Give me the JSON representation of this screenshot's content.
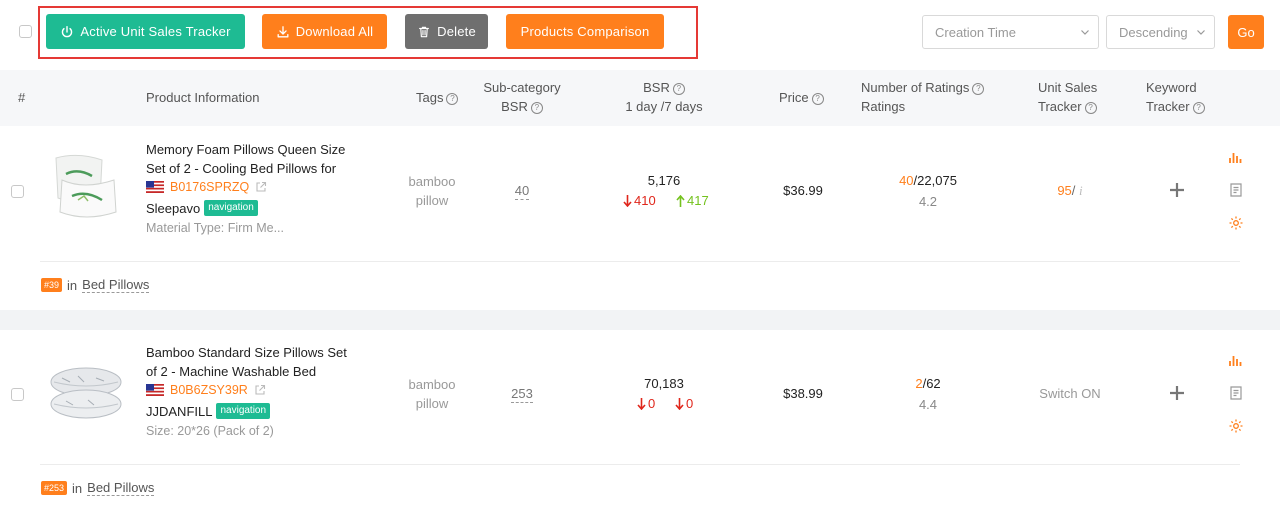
{
  "toolbar": {
    "active_tracker_label": "Active Unit Sales Tracker",
    "download_label": "Download All",
    "delete_label": "Delete",
    "compare_label": "Products Comparison",
    "sort_field": "Creation Time",
    "sort_order": "Descending",
    "go_label": "Go",
    "colors": {
      "green": "#1ebb93",
      "orange": "#ff7f1c",
      "gray": "#6f6f6f",
      "highlight": "#e53935"
    }
  },
  "header": {
    "index": "#",
    "product_info": "Product Information",
    "tags": "Tags",
    "subcat_line1": "Sub-category",
    "subcat_line2": "BSR",
    "bsr_line1": "BSR",
    "bsr_line2": "1 day /7 days",
    "price": "Price",
    "ratings_line1": "Number of Ratings",
    "ratings_line2": "Ratings",
    "ust_line1": "Unit Sales",
    "ust_line2": "Tracker",
    "kw_line1": "Keyword",
    "kw_line2": "Tracker"
  },
  "products": [
    {
      "title_line1": "Memory Foam Pillows Queen Size",
      "title_line2": "Set of 2 - Cooling Bed Pillows for",
      "asin": "B0176SPRZQ",
      "brand": "Sleepavo",
      "badge": "navigation",
      "meta": "Material Type: Firm Me...",
      "tag_line1": "bamboo",
      "tag_line2": "pillow",
      "subcat_bsr": "40",
      "bsr": "5,176",
      "bsr_1day": "410",
      "bsr_1day_dir": "down",
      "bsr_7day": "417",
      "bsr_7day_dir": "up",
      "price": "$36.99",
      "ratings_count": "40",
      "ratings_total": "/22,075",
      "rating": "4.2",
      "ust_value": "95",
      "ust_slash": "/",
      "ust_info": "i",
      "rank": "#39",
      "rank_in": "in",
      "rank_category": "Bed Pillows"
    },
    {
      "title_line1": "Bamboo Standard Size Pillows Set",
      "title_line2": "of 2 - Machine Washable Bed",
      "asin": "B0B6ZSY39R",
      "brand": "JJDANFILL",
      "badge": "navigation",
      "meta": "Size: 20*26 (Pack of 2)",
      "tag_line1": "bamboo",
      "tag_line2": "pillow",
      "subcat_bsr": "253",
      "bsr": "70,183",
      "bsr_1day": "0",
      "bsr_1day_dir": "down",
      "bsr_7day": "0",
      "bsr_7day_dir": "down",
      "price": "$38.99",
      "ratings_count": "2",
      "ratings_total": "/62",
      "rating": "4.4",
      "ust_switch": "Switch ON",
      "rank": "#253",
      "rank_in": "in",
      "rank_category": "Bed Pillows"
    }
  ]
}
